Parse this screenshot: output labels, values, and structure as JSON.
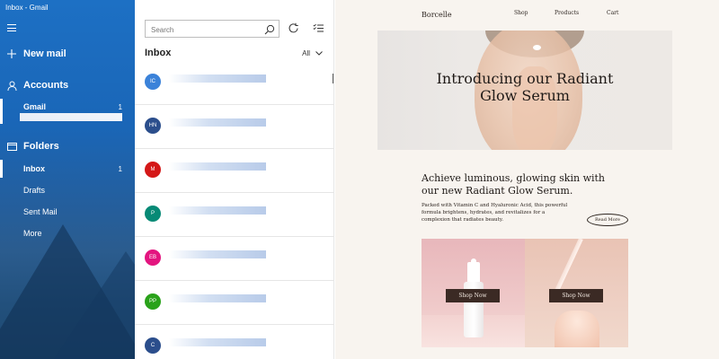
{
  "window": {
    "title": "Inbox - Gmail"
  },
  "sidebar": {
    "new_mail": "New mail",
    "accounts": "Accounts",
    "account": {
      "name": "Gmail",
      "count": "1"
    },
    "folders": "Folders",
    "items": [
      {
        "label": "Inbox",
        "count": "1"
      },
      {
        "label": "Drafts"
      },
      {
        "label": "Sent Mail"
      },
      {
        "label": "More"
      }
    ]
  },
  "maillist": {
    "search_placeholder": "Search",
    "header": "Inbox",
    "filter": "All",
    "messages": [
      {
        "initials": "IC",
        "color": "#3b82d9"
      },
      {
        "initials": "HN",
        "color": "#2b4e8c"
      },
      {
        "initials": "M",
        "color": "#d41818"
      },
      {
        "initials": "P",
        "color": "#078a76"
      },
      {
        "initials": "EB",
        "color": "#e3157f"
      },
      {
        "initials": "PP",
        "color": "#2aa21a"
      },
      {
        "initials": "C",
        "color": "#2b4e8c"
      }
    ]
  },
  "email": {
    "brand": "Borcelle",
    "nav": [
      "Shop",
      "Products",
      "Cart"
    ],
    "hero_title_line1": "Introducing our Radiant",
    "hero_title_line2": "Glow Serum",
    "headline_line1": "Achieve luminous, glowing skin with",
    "headline_line2": "our new Radiant Glow Serum.",
    "body_line1": "Packed with Vitamin C and Hyaluronic Acid, this powerful",
    "body_line2": "formula brightens, hydrates, and revitalizes for a",
    "body_line3": "complexion that radiates beauty.",
    "read_more": "Read More",
    "shop_now_1": "Shop Now",
    "shop_now_2": "Shop Now"
  }
}
